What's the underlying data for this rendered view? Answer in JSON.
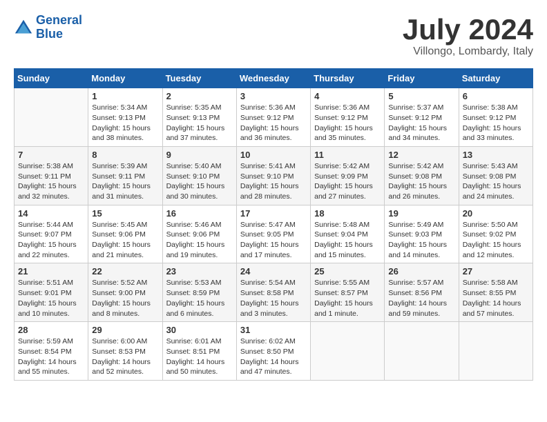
{
  "header": {
    "logo_line1": "General",
    "logo_line2": "Blue",
    "month_year": "July 2024",
    "location": "Villongo, Lombardy, Italy"
  },
  "calendar": {
    "days_of_week": [
      "Sunday",
      "Monday",
      "Tuesday",
      "Wednesday",
      "Thursday",
      "Friday",
      "Saturday"
    ],
    "weeks": [
      [
        {
          "day": "",
          "info": ""
        },
        {
          "day": "1",
          "info": "Sunrise: 5:34 AM\nSunset: 9:13 PM\nDaylight: 15 hours\nand 38 minutes."
        },
        {
          "day": "2",
          "info": "Sunrise: 5:35 AM\nSunset: 9:13 PM\nDaylight: 15 hours\nand 37 minutes."
        },
        {
          "day": "3",
          "info": "Sunrise: 5:36 AM\nSunset: 9:12 PM\nDaylight: 15 hours\nand 36 minutes."
        },
        {
          "day": "4",
          "info": "Sunrise: 5:36 AM\nSunset: 9:12 PM\nDaylight: 15 hours\nand 35 minutes."
        },
        {
          "day": "5",
          "info": "Sunrise: 5:37 AM\nSunset: 9:12 PM\nDaylight: 15 hours\nand 34 minutes."
        },
        {
          "day": "6",
          "info": "Sunrise: 5:38 AM\nSunset: 9:12 PM\nDaylight: 15 hours\nand 33 minutes."
        }
      ],
      [
        {
          "day": "7",
          "info": "Sunrise: 5:38 AM\nSunset: 9:11 PM\nDaylight: 15 hours\nand 32 minutes."
        },
        {
          "day": "8",
          "info": "Sunrise: 5:39 AM\nSunset: 9:11 PM\nDaylight: 15 hours\nand 31 minutes."
        },
        {
          "day": "9",
          "info": "Sunrise: 5:40 AM\nSunset: 9:10 PM\nDaylight: 15 hours\nand 30 minutes."
        },
        {
          "day": "10",
          "info": "Sunrise: 5:41 AM\nSunset: 9:10 PM\nDaylight: 15 hours\nand 28 minutes."
        },
        {
          "day": "11",
          "info": "Sunrise: 5:42 AM\nSunset: 9:09 PM\nDaylight: 15 hours\nand 27 minutes."
        },
        {
          "day": "12",
          "info": "Sunrise: 5:42 AM\nSunset: 9:08 PM\nDaylight: 15 hours\nand 26 minutes."
        },
        {
          "day": "13",
          "info": "Sunrise: 5:43 AM\nSunset: 9:08 PM\nDaylight: 15 hours\nand 24 minutes."
        }
      ],
      [
        {
          "day": "14",
          "info": "Sunrise: 5:44 AM\nSunset: 9:07 PM\nDaylight: 15 hours\nand 22 minutes."
        },
        {
          "day": "15",
          "info": "Sunrise: 5:45 AM\nSunset: 9:06 PM\nDaylight: 15 hours\nand 21 minutes."
        },
        {
          "day": "16",
          "info": "Sunrise: 5:46 AM\nSunset: 9:06 PM\nDaylight: 15 hours\nand 19 minutes."
        },
        {
          "day": "17",
          "info": "Sunrise: 5:47 AM\nSunset: 9:05 PM\nDaylight: 15 hours\nand 17 minutes."
        },
        {
          "day": "18",
          "info": "Sunrise: 5:48 AM\nSunset: 9:04 PM\nDaylight: 15 hours\nand 15 minutes."
        },
        {
          "day": "19",
          "info": "Sunrise: 5:49 AM\nSunset: 9:03 PM\nDaylight: 15 hours\nand 14 minutes."
        },
        {
          "day": "20",
          "info": "Sunrise: 5:50 AM\nSunset: 9:02 PM\nDaylight: 15 hours\nand 12 minutes."
        }
      ],
      [
        {
          "day": "21",
          "info": "Sunrise: 5:51 AM\nSunset: 9:01 PM\nDaylight: 15 hours\nand 10 minutes."
        },
        {
          "day": "22",
          "info": "Sunrise: 5:52 AM\nSunset: 9:00 PM\nDaylight: 15 hours\nand 8 minutes."
        },
        {
          "day": "23",
          "info": "Sunrise: 5:53 AM\nSunset: 8:59 PM\nDaylight: 15 hours\nand 6 minutes."
        },
        {
          "day": "24",
          "info": "Sunrise: 5:54 AM\nSunset: 8:58 PM\nDaylight: 15 hours\nand 3 minutes."
        },
        {
          "day": "25",
          "info": "Sunrise: 5:55 AM\nSunset: 8:57 PM\nDaylight: 15 hours\nand 1 minute."
        },
        {
          "day": "26",
          "info": "Sunrise: 5:57 AM\nSunset: 8:56 PM\nDaylight: 14 hours\nand 59 minutes."
        },
        {
          "day": "27",
          "info": "Sunrise: 5:58 AM\nSunset: 8:55 PM\nDaylight: 14 hours\nand 57 minutes."
        }
      ],
      [
        {
          "day": "28",
          "info": "Sunrise: 5:59 AM\nSunset: 8:54 PM\nDaylight: 14 hours\nand 55 minutes."
        },
        {
          "day": "29",
          "info": "Sunrise: 6:00 AM\nSunset: 8:53 PM\nDaylight: 14 hours\nand 52 minutes."
        },
        {
          "day": "30",
          "info": "Sunrise: 6:01 AM\nSunset: 8:51 PM\nDaylight: 14 hours\nand 50 minutes."
        },
        {
          "day": "31",
          "info": "Sunrise: 6:02 AM\nSunset: 8:50 PM\nDaylight: 14 hours\nand 47 minutes."
        },
        {
          "day": "",
          "info": ""
        },
        {
          "day": "",
          "info": ""
        },
        {
          "day": "",
          "info": ""
        }
      ]
    ]
  }
}
